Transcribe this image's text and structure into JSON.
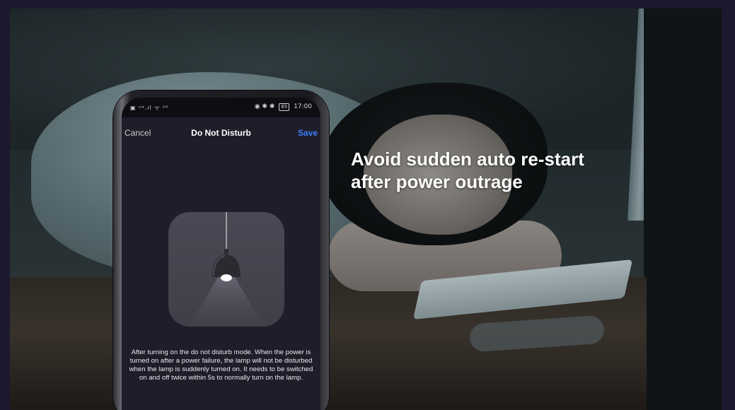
{
  "headline": "Avoid sudden auto re-start\nafter power outrage",
  "phone": {
    "status_bar": {
      "left_icons": "▣ ᵒᶰ.ıl ᯤ ⁰ᴷ",
      "right_icons": "◉ ✱ ✱",
      "battery": "85",
      "time": "17:00"
    },
    "nav": {
      "cancel_label": "Cancel",
      "title": "Do Not Disturb",
      "save_label": "Save"
    },
    "illustration": {
      "icon": "pendant-lamp-icon"
    },
    "description": "After turning on the do not disturb mode. When the power is turned on after a power failure, the lamp will not be disturbed when the lamp is suddenly turned on. It needs to be switched on and off twice within 5s to normally turn on the lamp."
  },
  "colors": {
    "frame_background": "#1b1830",
    "screen_background": "#1f1d29",
    "save_accent": "#3d7dff",
    "headline_text": "#ffffff"
  }
}
